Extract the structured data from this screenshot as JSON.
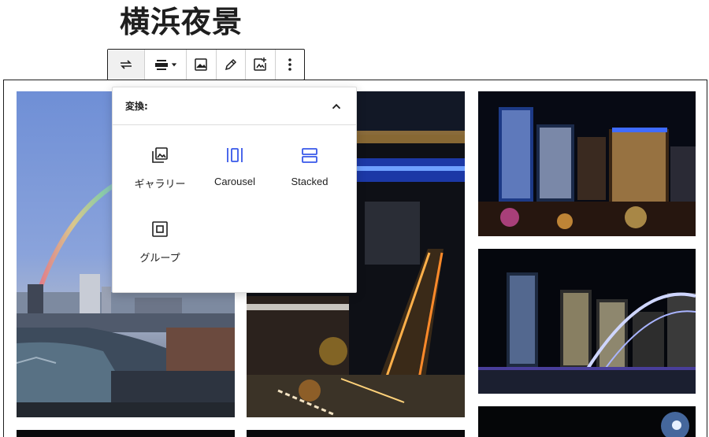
{
  "page": {
    "title": "横浜夜景"
  },
  "toolbar": {
    "buttons": [
      {
        "name": "transform-icon"
      },
      {
        "name": "align-icon"
      },
      {
        "name": "image-icon"
      },
      {
        "name": "pencil-icon"
      },
      {
        "name": "add-media-icon"
      },
      {
        "name": "more-options-icon"
      }
    ]
  },
  "popover": {
    "header": "変換:",
    "options": [
      {
        "label": "ギャラリー",
        "icon": "gallery-icon",
        "color": "#1e1e1e"
      },
      {
        "label": "Carousel",
        "icon": "carousel-icon",
        "color": "#3858e9"
      },
      {
        "label": "Stacked",
        "icon": "stacked-icon",
        "color": "#3858e9"
      },
      {
        "label": "グループ",
        "icon": "group-icon",
        "color": "#1e1e1e"
      }
    ]
  },
  "colors": {
    "accent": "#3858e9",
    "border": "#1e1e1e"
  }
}
